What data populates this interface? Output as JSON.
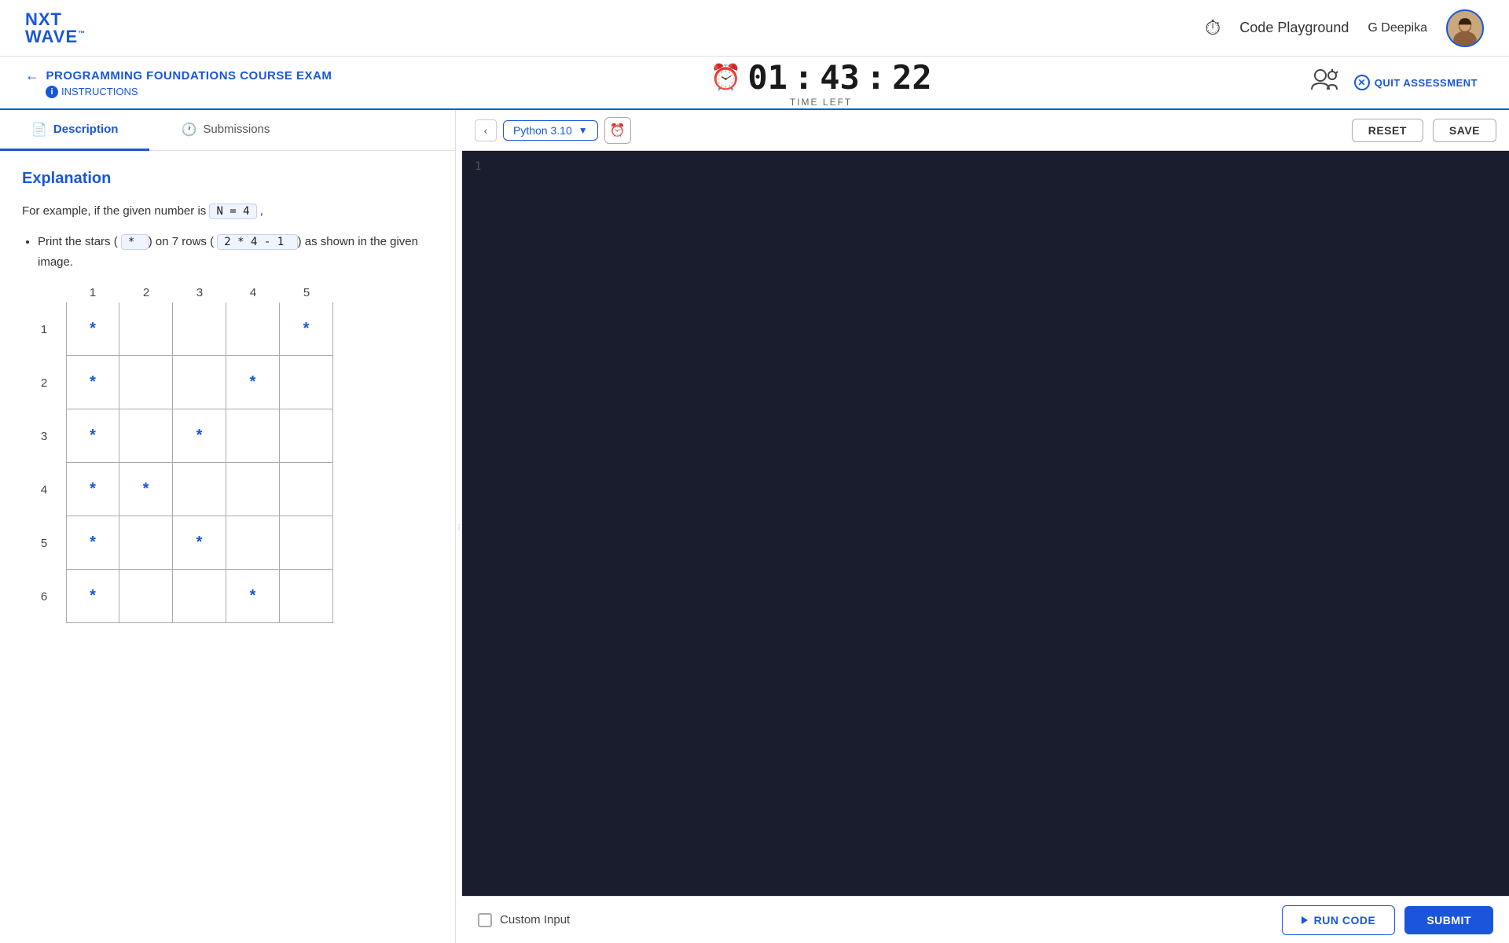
{
  "logo": {
    "nxt": "NXT",
    "wave": "WAV",
    "wave_e": "E",
    "tm": "™"
  },
  "nav": {
    "code_playground": "Code Playground",
    "user_name": "G Deepika"
  },
  "exam": {
    "back_arrow": "←",
    "title": "PROGRAMMING FOUNDATIONS COURSE EXAM",
    "instructions_label": "INSTRUCTIONS",
    "timer": {
      "hours": "01",
      "colon1": ":",
      "minutes": "43",
      "colon2": ":",
      "seconds": "22",
      "label": "TIME LEFT"
    },
    "quit_label": "QUIT ASSESSMENT"
  },
  "tabs": [
    {
      "id": "description",
      "label": "Description",
      "icon": "📄",
      "active": true
    },
    {
      "id": "submissions",
      "label": "Submissions",
      "icon": "🕐",
      "active": false
    }
  ],
  "description": {
    "section_title": "Explanation",
    "text1": "For example, if the given number is",
    "n_equals_4": "N = 4",
    "text1_end": ",",
    "bullet1_pre": "Print the stars (",
    "star_char": " * ",
    "bullet1_mid": ") on 7 rows (",
    "formula": " 2 * 4 - 1 ",
    "bullet1_end": ") as shown in the given image."
  },
  "grid": {
    "col_headers": [
      "1",
      "2",
      "3",
      "4",
      "5"
    ],
    "rows": [
      {
        "label": "1",
        "cells": [
          "*",
          "",
          "",
          "",
          "*"
        ]
      },
      {
        "label": "2",
        "cells": [
          "*",
          "",
          "",
          "*",
          ""
        ]
      },
      {
        "label": "3",
        "cells": [
          "*",
          "",
          "*",
          "",
          ""
        ]
      },
      {
        "label": "4",
        "cells": [
          "*",
          "*",
          "",
          "",
          ""
        ]
      },
      {
        "label": "5",
        "cells": [
          "*",
          "",
          "*",
          "",
          ""
        ]
      },
      {
        "label": "6",
        "cells": [
          "*",
          "",
          "",
          "*",
          ""
        ]
      }
    ]
  },
  "editor": {
    "language": "Python 3.10",
    "line_number": "1",
    "reset_label": "RESET",
    "save_label": "SAVE"
  },
  "bottom": {
    "custom_input_label": "Custom Input",
    "run_code_label": "RUN CODE",
    "submit_label": "SUBMIT"
  }
}
